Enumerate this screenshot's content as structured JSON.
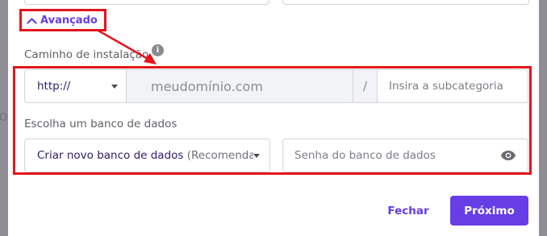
{
  "backdrop": {
    "partial_text": "Ot"
  },
  "advanced_toggle": {
    "label": "Avançado",
    "icon": "chevron-up-icon"
  },
  "install_path": {
    "label": "Caminho de instalação",
    "info_icon": "info-icon",
    "protocol_value": "http://",
    "domain_value": "meudomínio.com",
    "separator": "/",
    "subcategory_placeholder": "Insira a subcategoria"
  },
  "database": {
    "label": "Escolha um banco de dados",
    "select_value": "Criar novo banco de dados",
    "select_hint": "(Recomenda...",
    "password_placeholder": "Senha do banco de dados",
    "password_icon": "eye-icon"
  },
  "footer": {
    "close_label": "Fechar",
    "next_label": "Próximo"
  },
  "colors": {
    "accent": "#673de6",
    "highlight": "#e4141c",
    "text_dark": "#2f1c6a",
    "muted": "#5f5f66",
    "field_disabled_bg": "#f2f3f6",
    "backdrop": "#8e8e94"
  }
}
